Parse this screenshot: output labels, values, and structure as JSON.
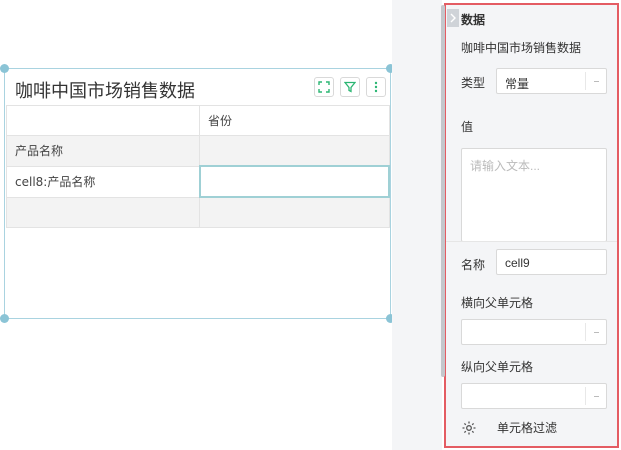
{
  "widget": {
    "title": "咖啡中国市场销售数据",
    "buttons": [
      "fullscreen-icon",
      "filter-icon",
      "more-icon"
    ],
    "table": {
      "header": [
        "",
        "省份"
      ],
      "rows": [
        [
          "产品名称",
          ""
        ],
        [
          "cell8:产品名称",
          ""
        ],
        [
          "",
          ""
        ]
      ]
    }
  },
  "panel": {
    "section_title": "数据",
    "dataset_name": "咖啡中国市场销售数据",
    "type_label": "类型",
    "type_value": "常量",
    "value_label": "值",
    "value_placeholder": "请输入文本...",
    "name_label": "名称",
    "name_value": "cell9",
    "h_parent_label": "横向父单元格",
    "h_parent_value": "",
    "v_parent_label": "纵向父单元格",
    "v_parent_value": "",
    "cell_filter_label": "单元格过滤"
  },
  "colors": {
    "selection": "#a9d3e0",
    "panel_border": "#e45c63",
    "accent_green": "#2bb673"
  }
}
